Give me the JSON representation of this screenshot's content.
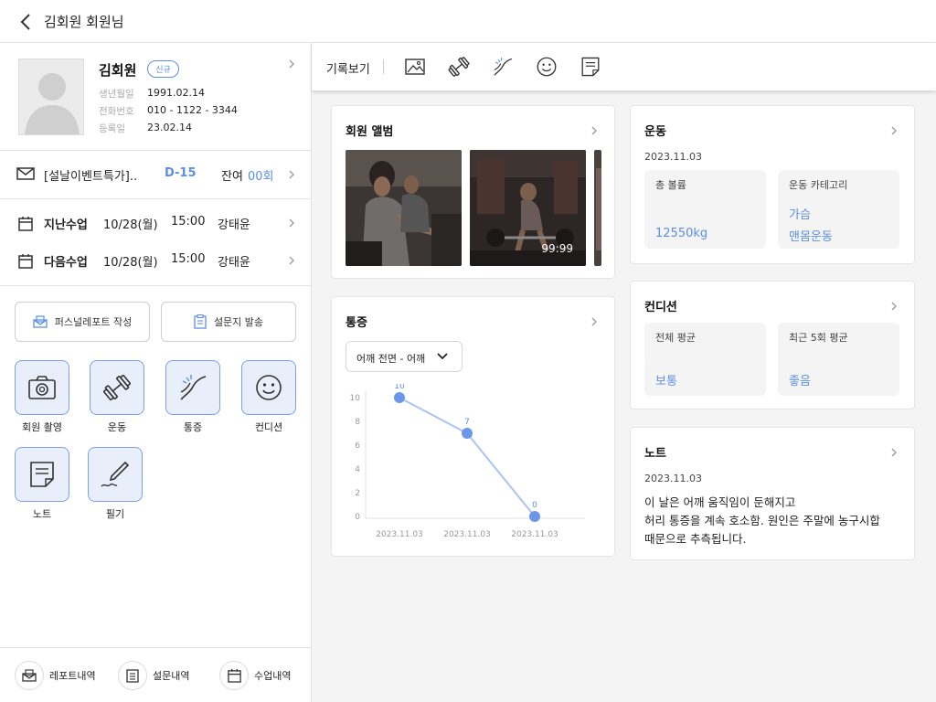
{
  "header": {
    "title": "김회원 회원님"
  },
  "member": {
    "name": "김회원",
    "badge": "신규",
    "info": [
      {
        "label": "생년월일",
        "value": "1991.02.14"
      },
      {
        "label": "전화번호",
        "value": "010 - 1122 - 3344"
      },
      {
        "label": "등록일",
        "value": "23.02.14"
      }
    ]
  },
  "membership": {
    "title": "[설날이벤트특가]..",
    "dday": "D-15",
    "remain_label": "잔여",
    "remain_value": "00회"
  },
  "lessons": [
    {
      "label": "지난수업",
      "date": "10/28(월)",
      "time": "15:00",
      "trainer": "강태윤"
    },
    {
      "label": "다음수업",
      "date": "10/28(월)",
      "time": "15:00",
      "trainer": "강태윤"
    }
  ],
  "actions": {
    "report": "퍼스널레포트 작성",
    "survey": "설문지 발송"
  },
  "tiles": [
    "회원 촬영",
    "운동",
    "통증",
    "컨디션",
    "노트",
    "필기"
  ],
  "bottom_nav": [
    "레포트내역",
    "설문내역",
    "수업내역"
  ],
  "toolbar": {
    "label": "기록보기",
    "icons": [
      "image-icon",
      "dumbbell-icon",
      "pain-icon",
      "smile-icon",
      "note-icon"
    ]
  },
  "album": {
    "title": "회원 앨범",
    "video_duration": "99:99"
  },
  "exercise": {
    "title": "운동",
    "date": "2023.11.03",
    "volume_label": "총 볼륨",
    "volume_value": "12550kg",
    "category_label": "운동 카테고리",
    "category_values": [
      "가슴",
      "맨몸운동"
    ]
  },
  "condition": {
    "title": "컨디션",
    "overall_label": "전체 평균",
    "overall_value": "보통",
    "recent_label": "최근 5회 평균",
    "recent_value": "좋음"
  },
  "pain": {
    "title": "통증",
    "dropdown": "어깨 전면 - 어깨"
  },
  "note": {
    "title": "노트",
    "date": "2023.11.03",
    "lines": [
      "이 날은 어깨 움직임이 둔해지고",
      "허리 통증을 계속 호소함. 원인은 주말에 농구시합",
      "때문으로 추측됩니다."
    ]
  },
  "chart_data": {
    "type": "line",
    "x": [
      "2023.11.03",
      "2023.11.03",
      "2023.11.03"
    ],
    "series": [
      {
        "values": [
          10,
          7,
          0
        ]
      }
    ],
    "ylim": [
      0,
      10
    ],
    "yticks": [
      0,
      2,
      4,
      6,
      8,
      10
    ],
    "grid": false,
    "colors": {
      "line": "#a9c4f0",
      "point": "#6b97ea",
      "label": "#5b8ee6"
    }
  },
  "colors": {
    "accent": "#5b8ee6",
    "tile_bg": "#e8effb",
    "panel_bg": "#f4f4f4"
  }
}
